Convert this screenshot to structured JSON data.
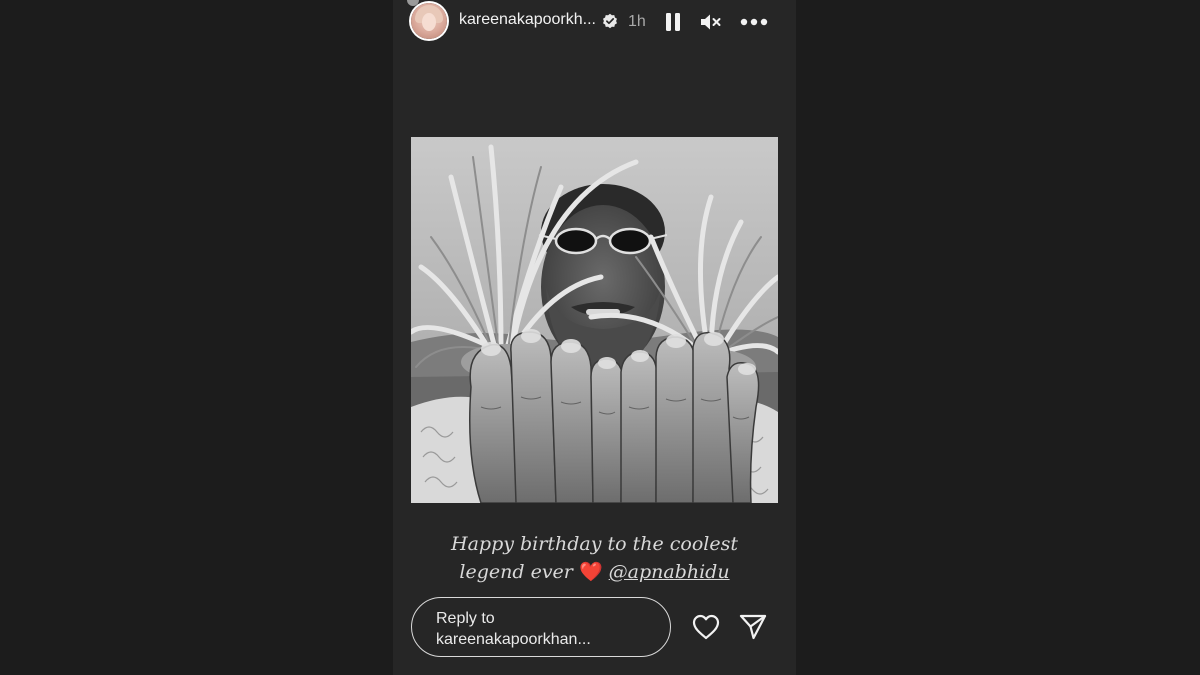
{
  "story": {
    "username": "kareenakapoorkh...",
    "verified": true,
    "timestamp": "1h",
    "caption": {
      "line1": "Happy birthday to the coolest",
      "line2_prefix": "legend ever",
      "emoji": "❤️",
      "mention": "@apnabhidu"
    },
    "reply": {
      "line1": "Reply to",
      "line2": "kareenakapoorkhan..."
    }
  },
  "icons": {
    "verified": "verified-badge-icon",
    "pause": "pause-icon",
    "mute": "speaker-muted-icon",
    "more": "more-horizontal-icon",
    "like": "heart-outline-icon",
    "share": "paper-plane-icon"
  },
  "colors": {
    "page_background": "#1c1c1c",
    "story_background": "#262626",
    "text": "#f2f2f2",
    "muted_text": "#a8a8a8",
    "emoji_heart": "#e0242f"
  }
}
